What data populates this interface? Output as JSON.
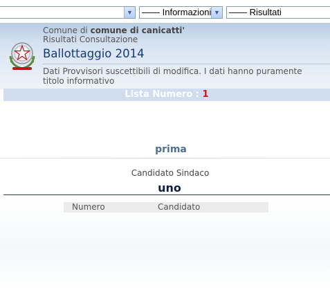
{
  "selectors": {
    "first": "",
    "second": "—— Informazioni",
    "third": "—— Risultati"
  },
  "header": {
    "comune_prefix": "Comune di",
    "comune_name": "comune di canicatti'",
    "subtitle": "Risultati Consultazione",
    "title": "Ballottaggio 2014",
    "disclaimer": "Dati Provvisori suscettibili di modifica. I dati hanno puramente titolo informativo"
  },
  "lista": {
    "label": "Lista Numero :",
    "number": "1",
    "name": "prima"
  },
  "candidate": {
    "label": "Candidato Sindaco",
    "name": "uno"
  },
  "table": {
    "headers": [
      "Numero",
      "Candidato"
    ]
  },
  "colors": {
    "title_blue": "#163a7a",
    "lista_number_red": "#d0101a",
    "list_name_blue": "#4f6f94"
  }
}
